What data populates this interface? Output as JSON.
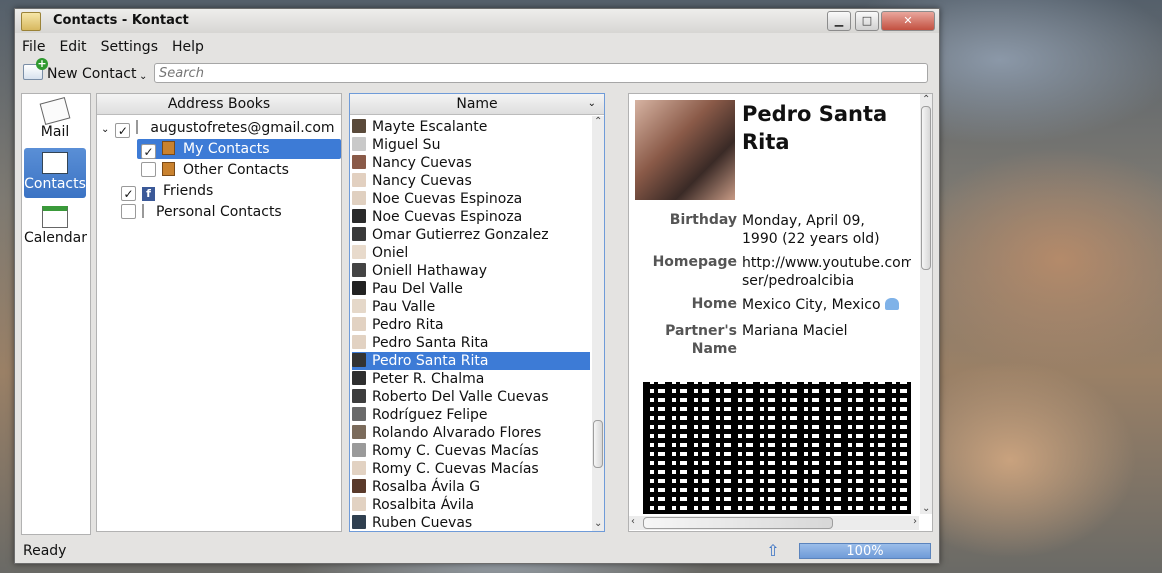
{
  "window": {
    "title": "Contacts - Kontact"
  },
  "menubar": {
    "items": [
      "File",
      "Edit",
      "Settings",
      "Help"
    ]
  },
  "toolbar": {
    "new_contact_label": "New Contact",
    "search_placeholder": "Search"
  },
  "sidebar": {
    "items": [
      {
        "label": "Mail",
        "icon": "mail-icon"
      },
      {
        "label": "Contacts",
        "icon": "contacts-icon",
        "active": true
      },
      {
        "label": "Calendar",
        "icon": "calendar-icon"
      }
    ]
  },
  "address_books": {
    "header": "Address Books",
    "items": [
      {
        "label": "augustofretes@gmail.com",
        "checked": true
      },
      {
        "label": "My Contacts",
        "checked": true,
        "selected": true
      },
      {
        "label": "Other Contacts",
        "checked": false
      },
      {
        "label": "Friends",
        "checked": true
      },
      {
        "label": "Personal Contacts",
        "checked": false
      }
    ]
  },
  "contact_list": {
    "header": "Name",
    "items": [
      "Mayte Escalante",
      "Miguel Su",
      "Nancy Cuevas",
      "Nancy Cuevas",
      "Noe Cuevas Espinoza",
      "Noe Cuevas Espinoza",
      "Omar Gutierrez Gonzalez",
      "Oniel",
      "Oniell Hathaway",
      "Pau Del Valle",
      "Pau Valle",
      "Pedro Rita",
      "Pedro Santa Rita",
      "Pedro Santa Rita",
      "Peter R. Chalma",
      "Roberto Del Valle Cuevas",
      "Rodríguez Felipe",
      "Rolando Alvarado Flores",
      "Romy C. Cuevas Macías",
      "Romy C. Cuevas Macías",
      "Rosalba Ávila G",
      "Rosalbita Ávila",
      "Ruben Cuevas"
    ],
    "selected_index": 13
  },
  "detail": {
    "name": "Pedro Santa Rita",
    "birthday_label": "Birthday",
    "birthday_line1": "Monday, April 09,",
    "birthday_line2": "1990  (22 years old)",
    "homepage_label": "Homepage",
    "homepage_line1": "http://www.youtube.com/u",
    "homepage_line2": "ser/pedroalcibia",
    "home_label": "Home",
    "home_value": "Mexico City, Mexico",
    "partner_label_line1": "Partner's",
    "partner_label_line2": "Name",
    "partner_value": "Mariana Maciel"
  },
  "statusbar": {
    "status": "Ready",
    "progress_text": "100%",
    "progress_fraction": 1.0
  }
}
